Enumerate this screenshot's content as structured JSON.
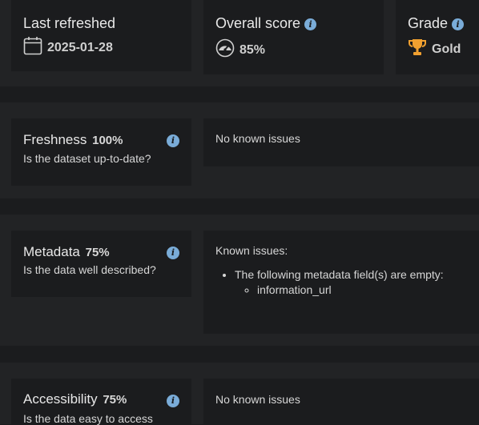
{
  "summary": {
    "last_refreshed": {
      "label": "Last refreshed",
      "value": "2025-01-28",
      "icon": "calendar-icon"
    },
    "overall_score": {
      "label": "Overall score",
      "value": "85%",
      "icon": "gauge-icon"
    },
    "grade": {
      "label": "Grade",
      "value": "Gold",
      "icon": "trophy-icon"
    }
  },
  "metrics": [
    {
      "name": "Freshness",
      "percent": "100%",
      "question": "Is the dataset up-to-date?",
      "issues_text": "No known issues"
    },
    {
      "name": "Metadata",
      "percent": "75%",
      "question": "Is the data well described?",
      "issues_text": "Known issues:",
      "issue_item": "The following metadata field(s) are empty:",
      "issue_subitem": "information_url"
    },
    {
      "name": "Accessibility",
      "percent": "75%",
      "question": "Is the data easy to access",
      "issues_text": "No known issues"
    }
  ],
  "info_glyph": "i",
  "colors": {
    "background": "#1b1c1e",
    "band": "#222325",
    "info": "#7aacd8",
    "trophy": "#f0a030"
  }
}
